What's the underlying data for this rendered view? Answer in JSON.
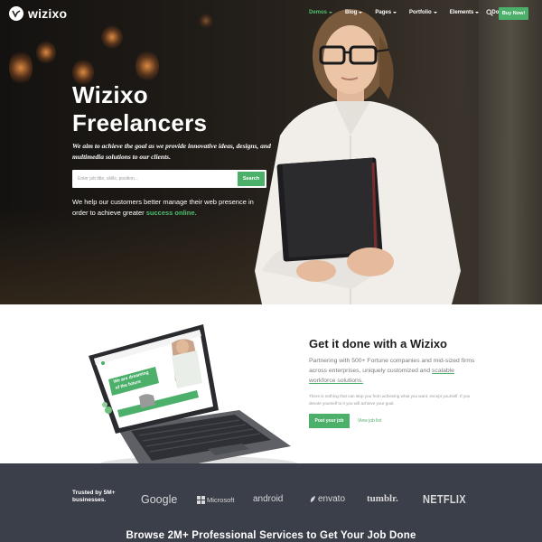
{
  "nav": {
    "logo_text": "wizixo",
    "items": [
      {
        "label": "Demos",
        "active": true
      },
      {
        "label": "Blog",
        "active": false
      },
      {
        "label": "Pages",
        "active": false
      },
      {
        "label": "Portfolio",
        "active": false
      },
      {
        "label": "Elements",
        "active": false
      },
      {
        "label": "Docs",
        "active": false
      }
    ],
    "search_icon": "search-icon",
    "buy_label": "Buy Now!"
  },
  "hero": {
    "title_line1": "Wizixo",
    "title_line2": "Freelancers",
    "subtitle": "We aim to achieve the goal as we provide innovative ideas, designs, and multimedia solutions to our clients.",
    "search_placeholder": "Enter job title, skills, position...",
    "search_button": "Search",
    "desc_prefix": "We help our customers better manage their web presence in order to achieve greater ",
    "desc_highlight": "success online."
  },
  "middle": {
    "title": "Get it done with a Wizixo",
    "sub_prefix": "Partnering with 500+ Fortune companies and mid-sized firms across enterprises, uniquely customized and ",
    "sub_link": "scalable workforce solutions.",
    "small_text": "There is nothing that can stop you from achieving what you want, except yourself. If you devote yourself to it you will achieve your goal.",
    "post_button": "Post your job",
    "view_link": "View job list",
    "laptop_screen": {
      "headline_line1": "We are dreaming",
      "headline_line2": "of the future"
    }
  },
  "bottom": {
    "trusted_line1": "Trusted by 5M+",
    "trusted_line2": "businesses.",
    "brands": [
      "Google",
      "Microsoft",
      "android",
      "envato",
      "tumblr.",
      "NETFLIX"
    ],
    "browse_title": "Browse 2M+ Professional Services to Get Your Job Done"
  },
  "colors": {
    "accent": "#4caf6a",
    "dark_band": "#3b3f4a"
  }
}
